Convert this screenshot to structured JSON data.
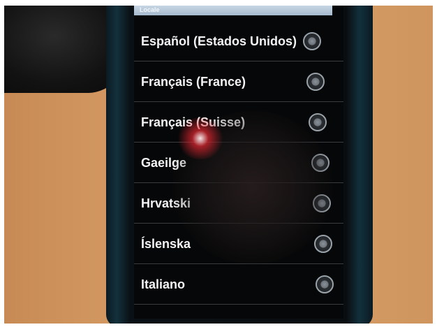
{
  "header": {
    "title": "Locale"
  },
  "locale_list": {
    "items": [
      {
        "label": "Español (Estados Unidos)"
      },
      {
        "label": "Français (France)"
      },
      {
        "label": "Français (Suisse)"
      },
      {
        "label": "Gaeilge"
      },
      {
        "label": "Hrvatski"
      },
      {
        "label": "Íslenska"
      },
      {
        "label": "Italiano"
      }
    ]
  },
  "icons": {
    "radio": "radio-button-unchecked-icon"
  },
  "colors": {
    "background": "#060708",
    "text": "#f3f3f3",
    "divider": "#3a3d40",
    "titlebar": "#b6c7d8"
  }
}
